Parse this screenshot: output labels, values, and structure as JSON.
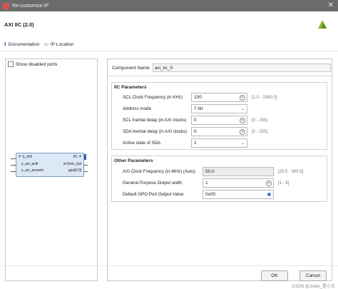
{
  "window": {
    "title": "Re-customize IP"
  },
  "header": {
    "ip_name": "AXI IIC (2.0)"
  },
  "links": {
    "documentation": "Documentation",
    "ip_location": "IP Location"
  },
  "left": {
    "show_disabled_ports": "Show disabled ports",
    "block": {
      "left_ports": [
        "S_AXI",
        "s_axi_aclk",
        "s_axi_aresetn"
      ],
      "right_ports": [
        "IIC",
        "iic2intc_irpt",
        "gpo[0:0]"
      ]
    }
  },
  "component": {
    "label": "Component Name",
    "value": "axi_iic_0"
  },
  "iic_params": {
    "title": "IIC Parameters",
    "rows": [
      {
        "label": "SCL Clock Frequency (in KHz)",
        "value": "100",
        "range": "[1.0 - 1000.0]"
      },
      {
        "label": "Address mode",
        "value": "7 bit",
        "range": ""
      },
      {
        "label": "SCL Inertial delay (in AXI clocks)",
        "value": "0",
        "range": "[0 - 255]"
      },
      {
        "label": "SDA Inertial delay (in AXI clocks)",
        "value": "0",
        "range": "[0 - 255]"
      },
      {
        "label": "Active state of SDA",
        "value": "1",
        "range": ""
      }
    ]
  },
  "other_params": {
    "title": "Other Parameters",
    "rows": [
      {
        "label": "AXI Clock Frequency (in MHz) (Auto)",
        "value": "50.0",
        "range": "[25.0 - 300.0]"
      },
      {
        "label": "General Purpose Output width",
        "value": "1",
        "range": "[1 - 8]"
      },
      {
        "label": "Default GPO Port Output Value",
        "value": "0x00",
        "range": ""
      }
    ]
  },
  "buttons": {
    "ok": "OK",
    "cancel": "Cancel"
  },
  "watermark": "CSDN @Joker_是小王",
  "colors": {
    "titlebar": "#6b6b6b",
    "logo_green": "#8db33a",
    "block_fill": "#dde8f6",
    "accent_blue": "#3b7dd8"
  },
  "icons": {
    "close": "close-icon",
    "documentation": "info-icon",
    "ip_location": "folder-icon",
    "logo": "vendor-logo-icon"
  }
}
